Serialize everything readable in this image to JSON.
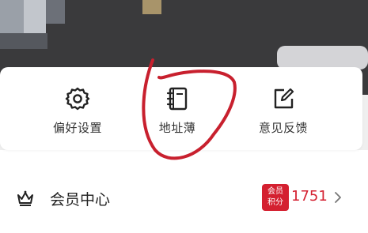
{
  "tools": [
    {
      "label": "偏好设置",
      "icon": "gear-icon"
    },
    {
      "label": "地址薄",
      "icon": "address-book-icon"
    },
    {
      "label": "意见反馈",
      "icon": "feedback-edit-icon"
    }
  ],
  "member": {
    "title": "会员中心",
    "badge_line1": "会员",
    "badge_line2": "积分",
    "points": "1751",
    "icon": "crown-icon",
    "chevron": "chevron-right-icon"
  },
  "colors": {
    "accent": "#d42030",
    "annotation": "#c8202e",
    "header": "#3a3a3c"
  }
}
